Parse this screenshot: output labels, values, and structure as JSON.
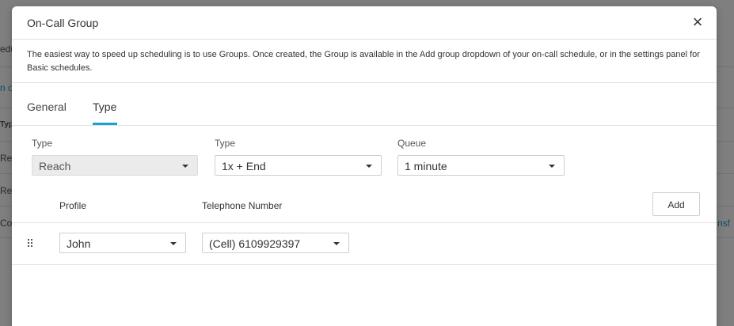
{
  "background": {
    "fragments": [
      {
        "text": "edu",
        "style": "normal"
      },
      {
        "text": "n or",
        "style": "link"
      },
      {
        "text": "Typ",
        "style": "bold"
      },
      {
        "text": "Re",
        "style": "normal"
      },
      {
        "text": "Re",
        "style": "normal"
      },
      {
        "text": "Co",
        "style": "normal"
      },
      {
        "text": "nsf",
        "style": "link"
      }
    ]
  },
  "modal": {
    "title": "On-Call Group",
    "close_label": "×",
    "description": "The easiest way to speed up scheduling is to use Groups. Once created, the Group is available in the Add group dropdown of your on-call schedule, or in the settings panel for Basic schedules."
  },
  "tabs": [
    {
      "label": "General",
      "active": false
    },
    {
      "label": "Type",
      "active": true
    }
  ],
  "fields": {
    "type1": {
      "label": "Type",
      "value": "Reach",
      "disabled": true
    },
    "type2": {
      "label": "Type",
      "value": "1x + End",
      "disabled": false
    },
    "queue": {
      "label": "Queue",
      "value": "1 minute",
      "disabled": false
    }
  },
  "table": {
    "columns": {
      "profile": "Profile",
      "telephone": "Telephone Number"
    },
    "add_label": "Add",
    "rows": [
      {
        "profile": "John",
        "telephone": "(Cell) 6109929397"
      }
    ]
  },
  "colors": {
    "accent": "#1a9fd6",
    "overlay": "#7f7f7f"
  }
}
